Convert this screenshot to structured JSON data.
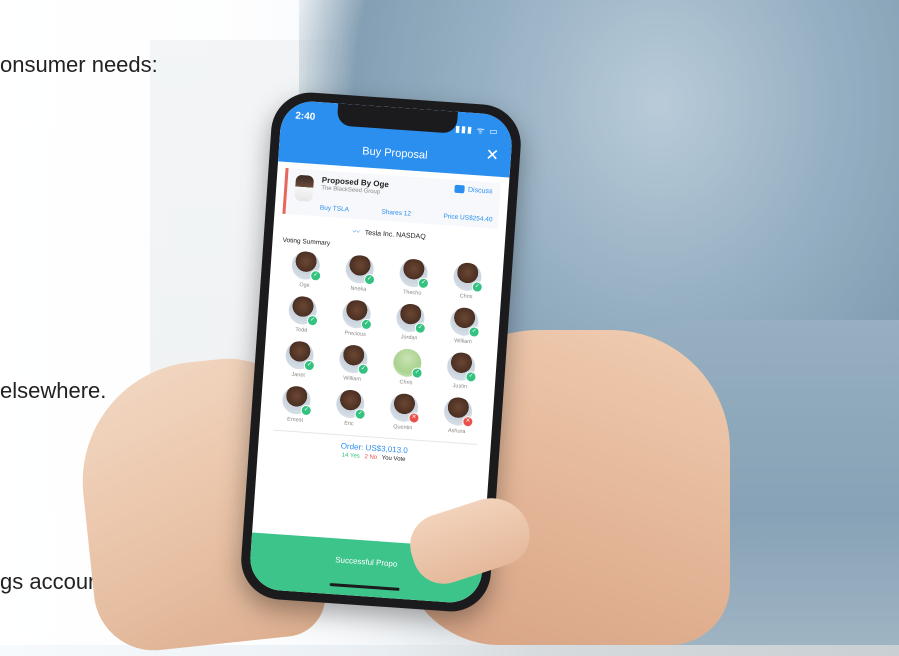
{
  "slide": {
    "line1": "onsumer needs:",
    "line2": "elsewhere.",
    "line3": "gs accounts."
  },
  "app": {
    "time": "2:40",
    "status_icons": "▮▮▮ ᯤ ▭",
    "title": "Buy Proposal",
    "close_label": "✕",
    "accent": "#2b8ff0",
    "proposal": {
      "proposed_by": "Proposed By Oge",
      "group": "The BlackSeed Group",
      "discuss_label": "Discuss",
      "action": "Buy TSLA",
      "shares": "Shares 12",
      "price": "Price US$254.40"
    },
    "ticker": "Tesla Inc. NASDAQ",
    "voting_summary_label": "Voting Summary",
    "voters": [
      {
        "name": "Oge",
        "vote": "yes"
      },
      {
        "name": "Nneka",
        "vote": "yes"
      },
      {
        "name": "Thecho",
        "vote": "yes"
      },
      {
        "name": "Chris",
        "vote": "yes"
      },
      {
        "name": "Todd",
        "vote": "yes"
      },
      {
        "name": "Precious",
        "vote": "yes"
      },
      {
        "name": "Jordan",
        "vote": "yes"
      },
      {
        "name": "William",
        "vote": "yes"
      },
      {
        "name": "Janet",
        "vote": "yes"
      },
      {
        "name": "William",
        "vote": "yes"
      },
      {
        "name": "Chris",
        "vote": "yes"
      },
      {
        "name": "Justin",
        "vote": "yes"
      },
      {
        "name": "Ernest",
        "vote": "yes"
      },
      {
        "name": "Eric",
        "vote": "yes"
      },
      {
        "name": "Quentin",
        "vote": "no"
      },
      {
        "name": "Ashura",
        "vote": "no"
      }
    ],
    "order_label": "Order: US$3,013.0",
    "yes_count": "14 Yes",
    "no_count": "2 No",
    "you_voted": "You Vote",
    "bottom_button": "Successful Propo"
  }
}
